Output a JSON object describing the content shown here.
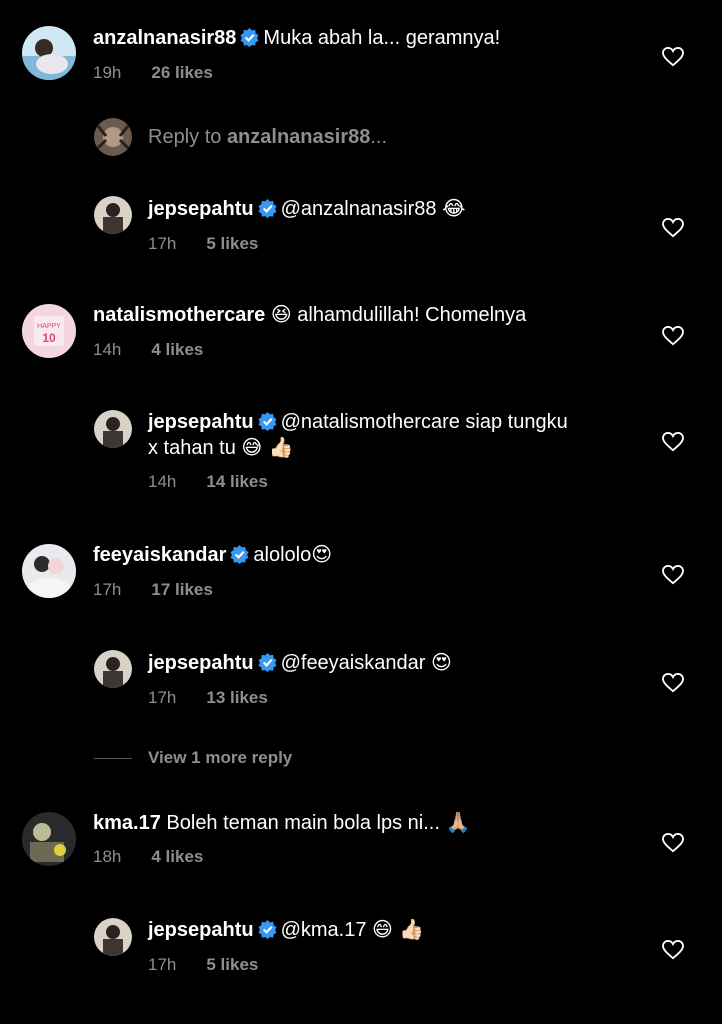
{
  "comments": [
    {
      "user": "anzalnanasir88",
      "text": "Muka abah la... geramnya!",
      "time": "19h",
      "likes": "26 likes"
    },
    {
      "reply_prompt_prefix": "Reply to ",
      "reply_prompt_user": "anzalnanasir88",
      "reply_prompt_suffix": "..."
    },
    {
      "user": "jepsepahtu",
      "text": "@anzalnanasir88",
      "emoji": "😂",
      "time": "17h",
      "likes": "5 likes"
    },
    {
      "user": "natalismothercare",
      "emoji": "😆",
      "text": "alhamdulillah! Chomelnya",
      "time": "14h",
      "likes": "4 likes"
    },
    {
      "user": "jepsepahtu",
      "text": "@natalismothercare siap tungku",
      "text2": "x tahan tu",
      "emoji": "😅 👍🏻",
      "time": "14h",
      "likes": "14 likes"
    },
    {
      "user": "feeyaiskandar",
      "text": "alololo",
      "emoji": "😍",
      "time": "17h",
      "likes": "17 likes"
    },
    {
      "user": "jepsepahtu",
      "text": "@feeyaiskandar",
      "emoji": "😍",
      "time": "17h",
      "likes": "13 likes"
    },
    {
      "view_more": "View 1 more reply"
    },
    {
      "user": "kma.17",
      "text": "Boleh teman main bola lps ni...",
      "emoji": "🙏🏼",
      "time": "18h",
      "likes": "4 likes"
    },
    {
      "user": "jepsepahtu",
      "text": "@kma.17",
      "emoji": "😄 👍🏻",
      "time": "17h",
      "likes": "5 likes"
    }
  ],
  "icons": {
    "verified": "verified-badge-icon",
    "heart": "heart-outline-icon"
  },
  "colors": {
    "background": "#000000",
    "verified": "#3897f0",
    "meta": "#8e8e8e"
  }
}
